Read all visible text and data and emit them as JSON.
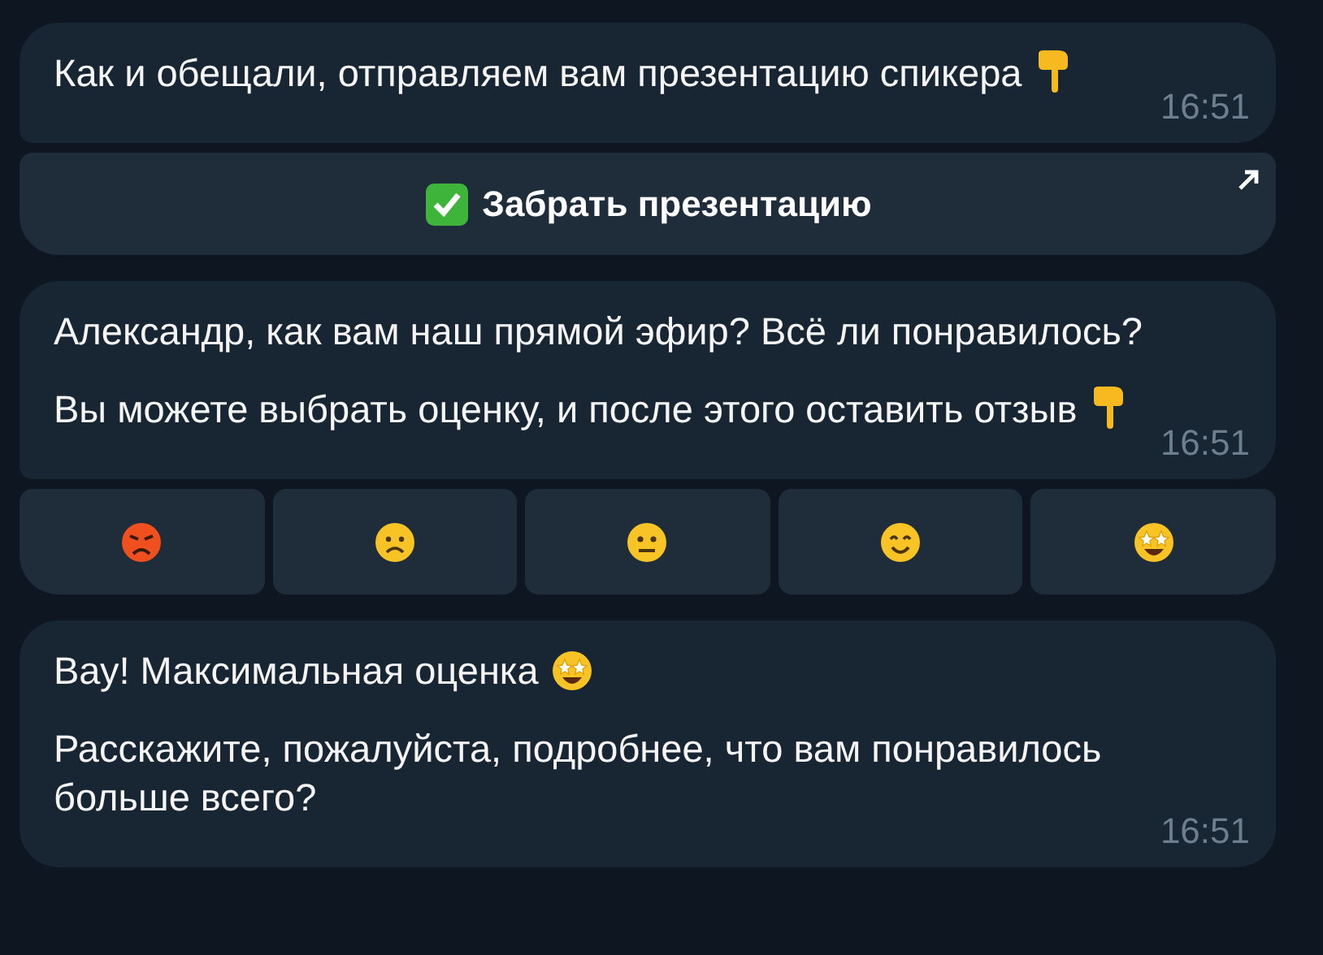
{
  "messages": [
    {
      "paragraphs": [
        {
          "kind": "pointing-hand",
          "text": "Как и обещали, отправляем вам презентацию спикера"
        }
      ],
      "time": "16:51",
      "keyboard": [
        [
          {
            "kind": "url",
            "label": "Забрать презентацию"
          }
        ]
      ]
    },
    {
      "paragraphs": [
        {
          "kind": "plain",
          "text": "Александр, как вам наш прямой эфир? Всё ли понравилось?"
        },
        {
          "kind": "pointing-hand",
          "text": "Вы можете выбрать оценку, и после этого оставить отзыв"
        }
      ],
      "time": "16:51",
      "keyboard": [
        [
          {
            "kind": "angry"
          },
          {
            "kind": "sad"
          },
          {
            "kind": "neutral"
          },
          {
            "kind": "smile"
          },
          {
            "kind": "star-struck"
          }
        ]
      ]
    },
    {
      "paragraphs": [
        {
          "kind": "star-struck",
          "text": "Вау! Максимальная оценка"
        },
        {
          "kind": "plain",
          "text": "Расскажите, пожалуйста, подробнее, что вам понравилось больше всего?"
        }
      ],
      "time": "16:51"
    }
  ]
}
